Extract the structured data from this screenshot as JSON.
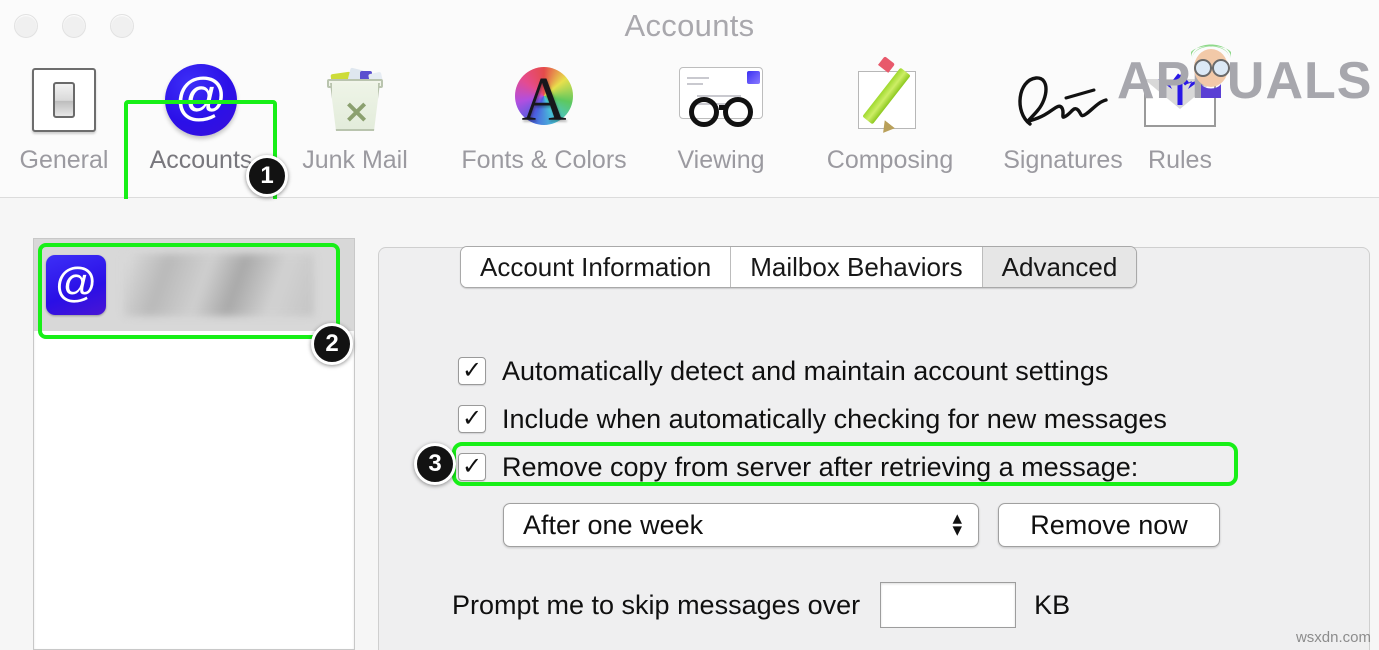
{
  "window": {
    "title": "Accounts",
    "traffic_lights": [
      "close",
      "minimize",
      "zoom"
    ]
  },
  "toolbar": {
    "items": [
      {
        "label": "General",
        "icon": "light-switch-icon",
        "selected": false
      },
      {
        "label": "Accounts",
        "icon": "at-sign-icon",
        "selected": true
      },
      {
        "label": "Junk Mail",
        "icon": "trash-can-icon",
        "selected": false
      },
      {
        "label": "Fonts & Colors",
        "icon": "font-color-wheel-icon",
        "selected": false
      },
      {
        "label": "Viewing",
        "icon": "eyeglasses-icon",
        "selected": false
      },
      {
        "label": "Composing",
        "icon": "pencil-page-icon",
        "selected": false
      },
      {
        "label": "Signatures",
        "icon": "signature-icon",
        "selected": false
      },
      {
        "label": "Rules",
        "icon": "envelope-arrows-icon",
        "selected": false
      }
    ]
  },
  "watermark": {
    "brand": "APPUALS",
    "footer": "wsxdn.com"
  },
  "accounts_list": {
    "rows": [
      {
        "avatar_icon": "at-sign-icon",
        "name_redacted": true,
        "selected": true
      }
    ]
  },
  "panel": {
    "tabs": [
      {
        "label": "Account Information",
        "active": false
      },
      {
        "label": "Mailbox Behaviors",
        "active": false
      },
      {
        "label": "Advanced",
        "active": true
      }
    ],
    "checkboxes": [
      {
        "label": "Automatically detect and maintain account settings",
        "checked": true,
        "glyph": "✓"
      },
      {
        "label": "Include when automatically checking for new messages",
        "checked": true,
        "glyph": "✓"
      },
      {
        "label": "Remove copy from server after retrieving a message:",
        "checked": true,
        "glyph": "✓"
      }
    ],
    "remove_delay_popup": {
      "value": "After one week",
      "chevron_up": "▴",
      "chevron_down": "▾"
    },
    "remove_now_button": "Remove now",
    "skip_messages": {
      "label": "Prompt me to skip messages over",
      "value": "",
      "unit": "KB"
    }
  },
  "callouts": [
    {
      "number": "1",
      "target": "toolbar-accounts"
    },
    {
      "number": "2",
      "target": "account-list-row"
    },
    {
      "number": "3",
      "target": "remove-copy-checkbox"
    }
  ],
  "colors": {
    "highlight_green": "#17ef17",
    "badge_black": "#121212",
    "accent_blue": "#2b10e8"
  }
}
